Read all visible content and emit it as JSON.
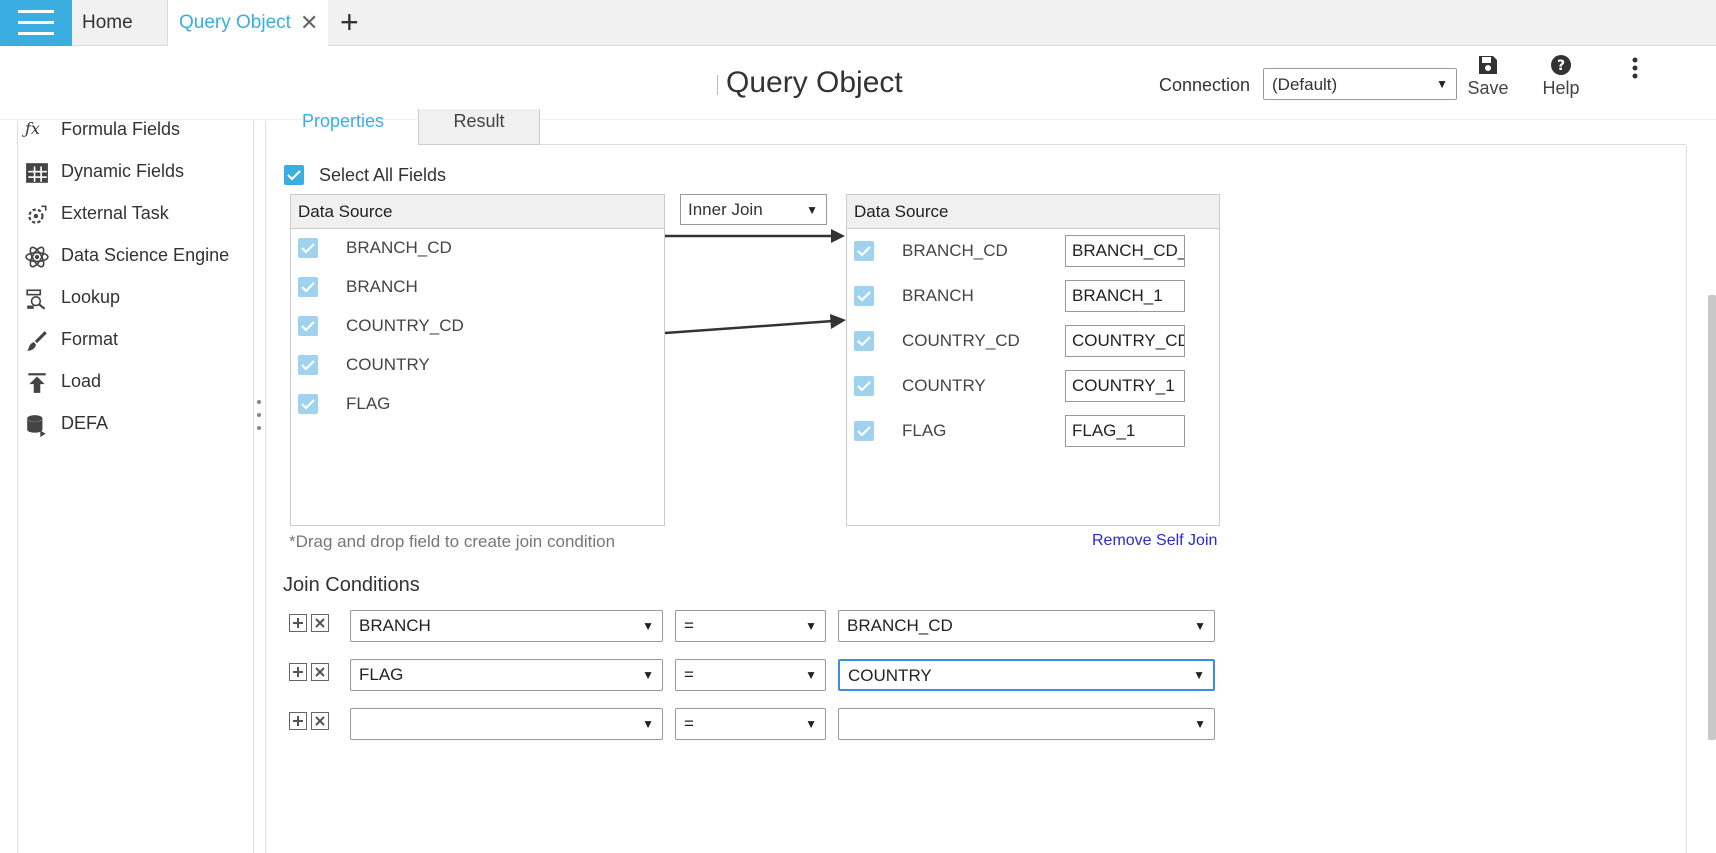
{
  "tabs": {
    "home": "Home",
    "active": "Query Object",
    "close_glyph": "✕",
    "add_glyph": "+"
  },
  "header": {
    "title": "Query Object",
    "connection_label": "Connection",
    "connection_value": "(Default)",
    "save_label": "Save",
    "help_label": "Help"
  },
  "sidebar": {
    "items": [
      {
        "label": "Formula Fields",
        "icon": "function-icon"
      },
      {
        "label": "Dynamic Fields",
        "icon": "table-columns-icon"
      },
      {
        "label": "External Task",
        "icon": "gear-person-icon"
      },
      {
        "label": "Data Science Engine",
        "icon": "atom-icon"
      },
      {
        "label": "Lookup",
        "icon": "lookup-icon"
      },
      {
        "label": "Format",
        "icon": "paintbrush-icon"
      },
      {
        "label": "Load",
        "icon": "upload-icon"
      },
      {
        "label": "DEFA",
        "icon": "database-icon"
      }
    ]
  },
  "panel_tabs": {
    "properties": "Properties",
    "result": "Result"
  },
  "select_all_label": "Select All Fields",
  "join_type": "Inner Join",
  "left_source": {
    "header": "Data Source",
    "fields": [
      "BRANCH_CD",
      "BRANCH",
      "COUNTRY_CD",
      "COUNTRY",
      "FLAG"
    ]
  },
  "right_source": {
    "header": "Data Source",
    "fields": [
      {
        "name": "BRANCH_CD",
        "alias": "BRANCH_CD_"
      },
      {
        "name": "BRANCH",
        "alias": "BRANCH_1"
      },
      {
        "name": "COUNTRY_CD",
        "alias": "COUNTRY_CD"
      },
      {
        "name": "COUNTRY",
        "alias": "COUNTRY_1"
      },
      {
        "name": "FLAG",
        "alias": "FLAG_1"
      }
    ]
  },
  "hint": "*Drag and drop field to create join condition",
  "remove_self_join": "Remove Self Join",
  "join_conditions": {
    "title": "Join Conditions",
    "rows": [
      {
        "left": "BRANCH",
        "op": "=",
        "right": "BRANCH_CD"
      },
      {
        "left": "FLAG",
        "op": "=",
        "right": "COUNTRY"
      },
      {
        "left": "",
        "op": "=",
        "right": ""
      }
    ]
  },
  "colors": {
    "accent": "#3aaee0",
    "link": "#2a2ad4"
  }
}
